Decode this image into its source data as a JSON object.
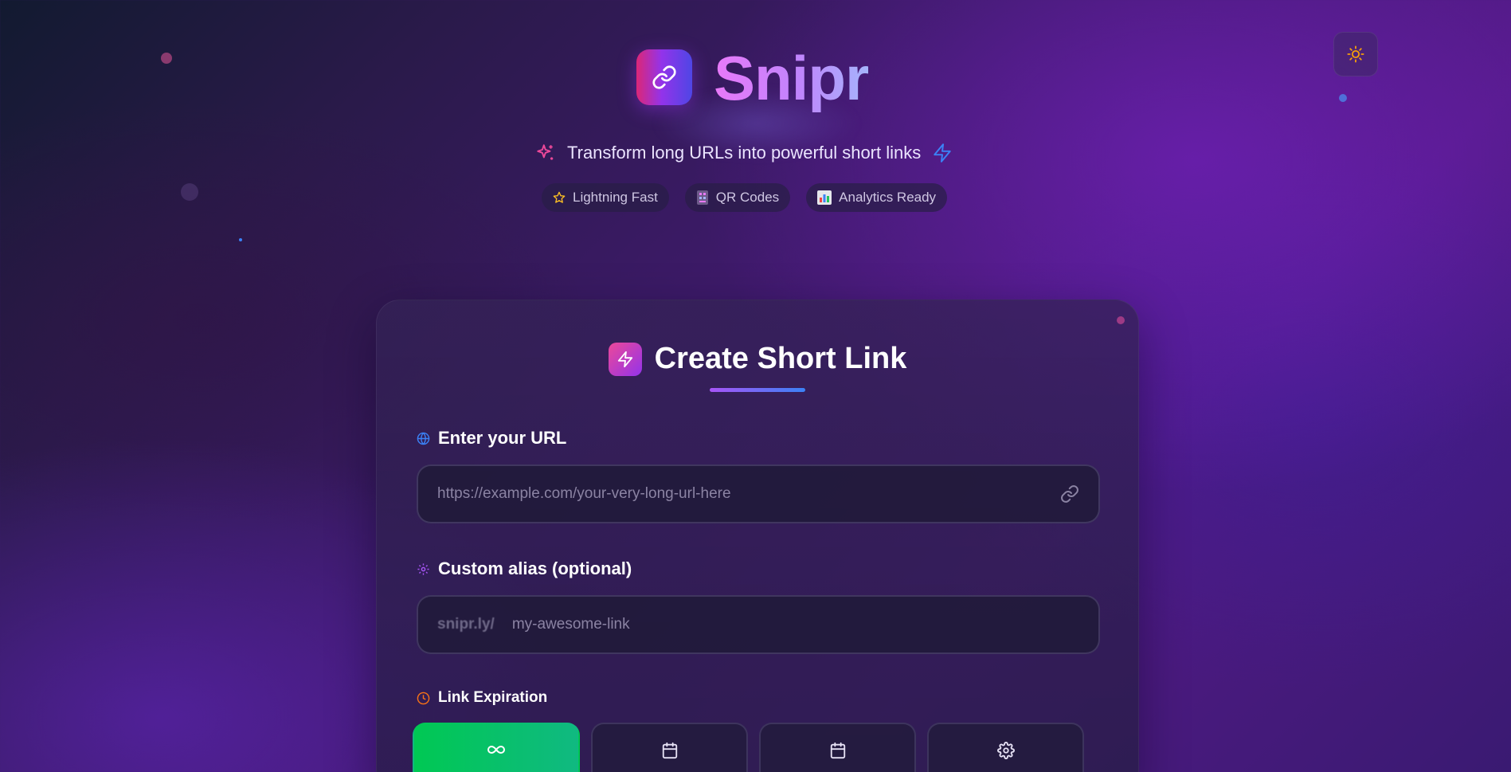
{
  "app": {
    "title": "Snipr",
    "tagline": "Transform long URLs into powerful short links"
  },
  "features": [
    {
      "label": "Lightning Fast",
      "icon": "star-icon"
    },
    {
      "label": "QR Codes",
      "icon": "qr-code-icon"
    },
    {
      "label": "Analytics Ready",
      "icon": "bar-chart-icon"
    }
  ],
  "card": {
    "title": "Create Short Link",
    "url": {
      "label": "Enter your URL",
      "placeholder": "https://example.com/your-very-long-url-here",
      "value": ""
    },
    "alias": {
      "label": "Custom alias (optional)",
      "prefix": "snipr.ly/",
      "placeholder": "my-awesome-link",
      "value": ""
    },
    "expiration": {
      "label": "Link Expiration",
      "options": [
        {
          "icon": "infinity-icon",
          "selected": true
        },
        {
          "icon": "calendar-icon",
          "selected": false
        },
        {
          "icon": "calendar-icon",
          "selected": false
        },
        {
          "icon": "gear-icon",
          "selected": false
        }
      ]
    }
  },
  "colors": {
    "brand_gradient": [
      "#db2777",
      "#9333ea",
      "#4f46e5"
    ],
    "selected_option": "#00c853",
    "theme_icon": "#f59e0b"
  }
}
